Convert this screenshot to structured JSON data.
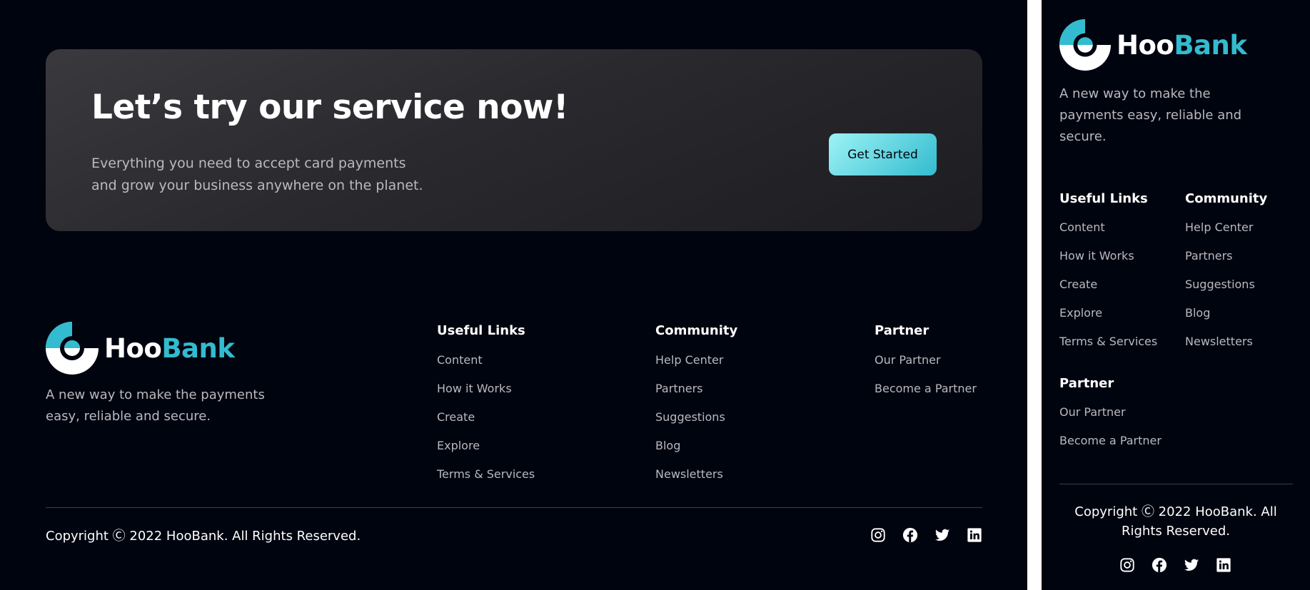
{
  "cta": {
    "title": "Let’s try our service now!",
    "text": "Everything you need to accept card payments and grow your business anywhere on the planet.",
    "button_label": "Get Started"
  },
  "brand": {
    "name_part1": "Hoo",
    "name_part2": "Bank",
    "tagline": "A new way to make the payments easy, reliable and secure."
  },
  "footer": {
    "columns": [
      {
        "title": "Useful Links",
        "links": [
          "Content",
          "How it Works",
          "Create",
          "Explore",
          "Terms & Services"
        ]
      },
      {
        "title": "Community",
        "links": [
          "Help Center",
          "Partners",
          "Suggestions",
          "Blog",
          "Newsletters"
        ]
      },
      {
        "title": "Partner",
        "links": [
          "Our Partner",
          "Become a Partner"
        ]
      }
    ],
    "copyright": "Copyright Ⓒ 2022 HooBank. All Rights Reserved.",
    "socials": [
      "instagram-icon",
      "facebook-icon",
      "twitter-icon",
      "linkedin-icon"
    ]
  },
  "colors": {
    "background": "#00040f",
    "accent": "#33bbcf",
    "muted_text": "#b9b9bf"
  }
}
